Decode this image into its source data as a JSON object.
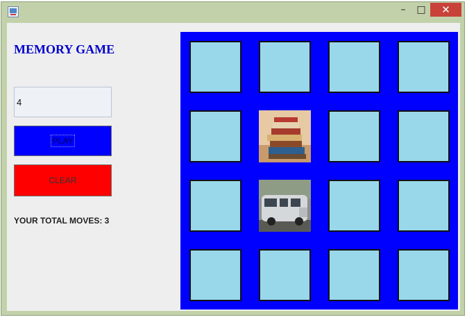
{
  "window": {
    "controls": {
      "minimize_icon": "minimize-icon",
      "maximize_icon": "maximize-icon",
      "close_icon": "close-icon"
    }
  },
  "game": {
    "title": "MEMORY GAME",
    "grid_size_value": "4",
    "play_label": "PLAY",
    "clear_label": "CLEAR",
    "moves_text": "YOUR TOTAL MOVES: 3"
  },
  "board": {
    "rows": 4,
    "cols": 4,
    "cells": [
      {
        "state": "hidden"
      },
      {
        "state": "hidden"
      },
      {
        "state": "hidden"
      },
      {
        "state": "hidden"
      },
      {
        "state": "hidden"
      },
      {
        "state": "revealed",
        "image": "stack-of-books"
      },
      {
        "state": "hidden"
      },
      {
        "state": "hidden"
      },
      {
        "state": "hidden"
      },
      {
        "state": "revealed",
        "image": "silver-van"
      },
      {
        "state": "hidden"
      },
      {
        "state": "hidden"
      },
      {
        "state": "hidden"
      },
      {
        "state": "hidden"
      },
      {
        "state": "hidden"
      },
      {
        "state": "hidden"
      }
    ]
  },
  "colors": {
    "board_background": "#0000ff",
    "card_back": "#99d8ea",
    "play_button": "#0000ff",
    "clear_button": "#ff0000",
    "title_text": "#0000cc"
  }
}
